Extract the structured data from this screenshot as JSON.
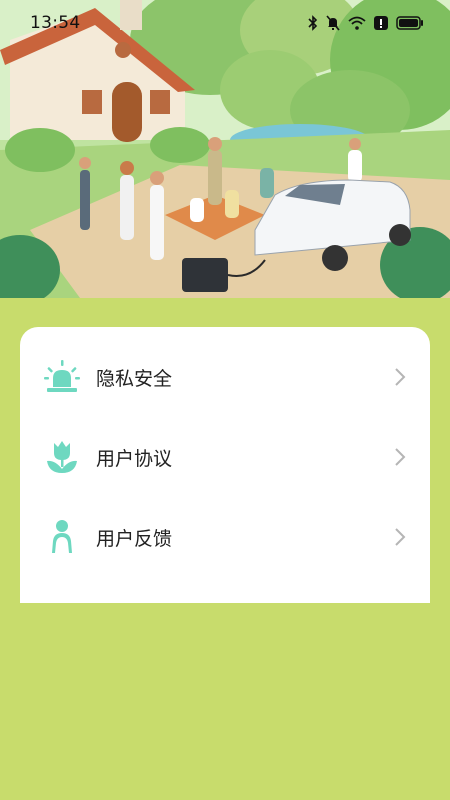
{
  "status_bar": {
    "time": "13:54",
    "icons": [
      "bluetooth-icon",
      "mute-bell-icon",
      "wifi-icon",
      "alert-icon",
      "battery-icon"
    ]
  },
  "hero": {
    "image": "illustration: cottage, people picnicking beside a white car with a portable power station, pond and trees"
  },
  "menu": {
    "items": [
      {
        "label": "隐私安全",
        "icon": "alarm-light-icon"
      },
      {
        "label": "用户协议",
        "icon": "tulip-icon"
      },
      {
        "label": "用户反馈",
        "icon": "person-icon"
      }
    ]
  },
  "colors": {
    "page_background": "#c8dc6c",
    "accent": "#6ed8c0",
    "card": "#ffffff"
  }
}
